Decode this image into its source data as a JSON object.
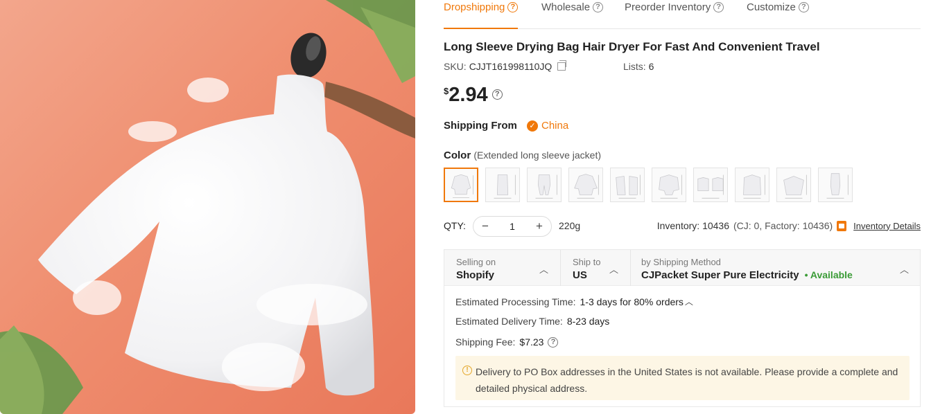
{
  "tabs": [
    {
      "label": "Dropshipping",
      "active": true
    },
    {
      "label": "Wholesale",
      "active": false
    },
    {
      "label": "Preorder Inventory",
      "active": false
    },
    {
      "label": "Customize",
      "active": false
    }
  ],
  "product": {
    "title": "Long Sleeve Drying Bag Hair Dryer For Fast And Convenient Travel",
    "sku_label": "SKU:",
    "sku": "CJJT161998110JQ",
    "lists_label": "Lists:",
    "lists": "6",
    "currency": "$",
    "price": "2.94"
  },
  "shipping_from": {
    "label": "Shipping From",
    "origin": "China"
  },
  "color": {
    "label": "Color",
    "selected": "(Extended long sleeve jacket)",
    "swatch_count": 10
  },
  "quantity": {
    "label": "QTY:",
    "value": "1",
    "minus": "−",
    "plus": "+",
    "weight": "220g"
  },
  "inventory": {
    "text": "Inventory: 10436",
    "breakdown": "(CJ: 0, Factory: 10436)",
    "link": "Inventory Details"
  },
  "shipping": {
    "selling_on_label": "Selling on",
    "selling_on": "Shopify",
    "ship_to_label": "Ship to",
    "ship_to": "US",
    "method_label": "by Shipping Method",
    "method": "CJPacket Super Pure Electricity",
    "availability": "• Available",
    "processing_label": "Estimated Processing Time:",
    "processing": "1-3 days for 80% orders",
    "delivery_label": "Estimated Delivery Time:",
    "delivery": "8-23 days",
    "fee_label": "Shipping Fee:",
    "fee": "$7.23",
    "notice": "Delivery to PO Box addresses in the United States is not available. Please provide a complete and detailed physical address."
  },
  "colors": {
    "accent": "#f0780a",
    "available": "#3a9b36",
    "notice_bg": "#fdf6e5"
  }
}
